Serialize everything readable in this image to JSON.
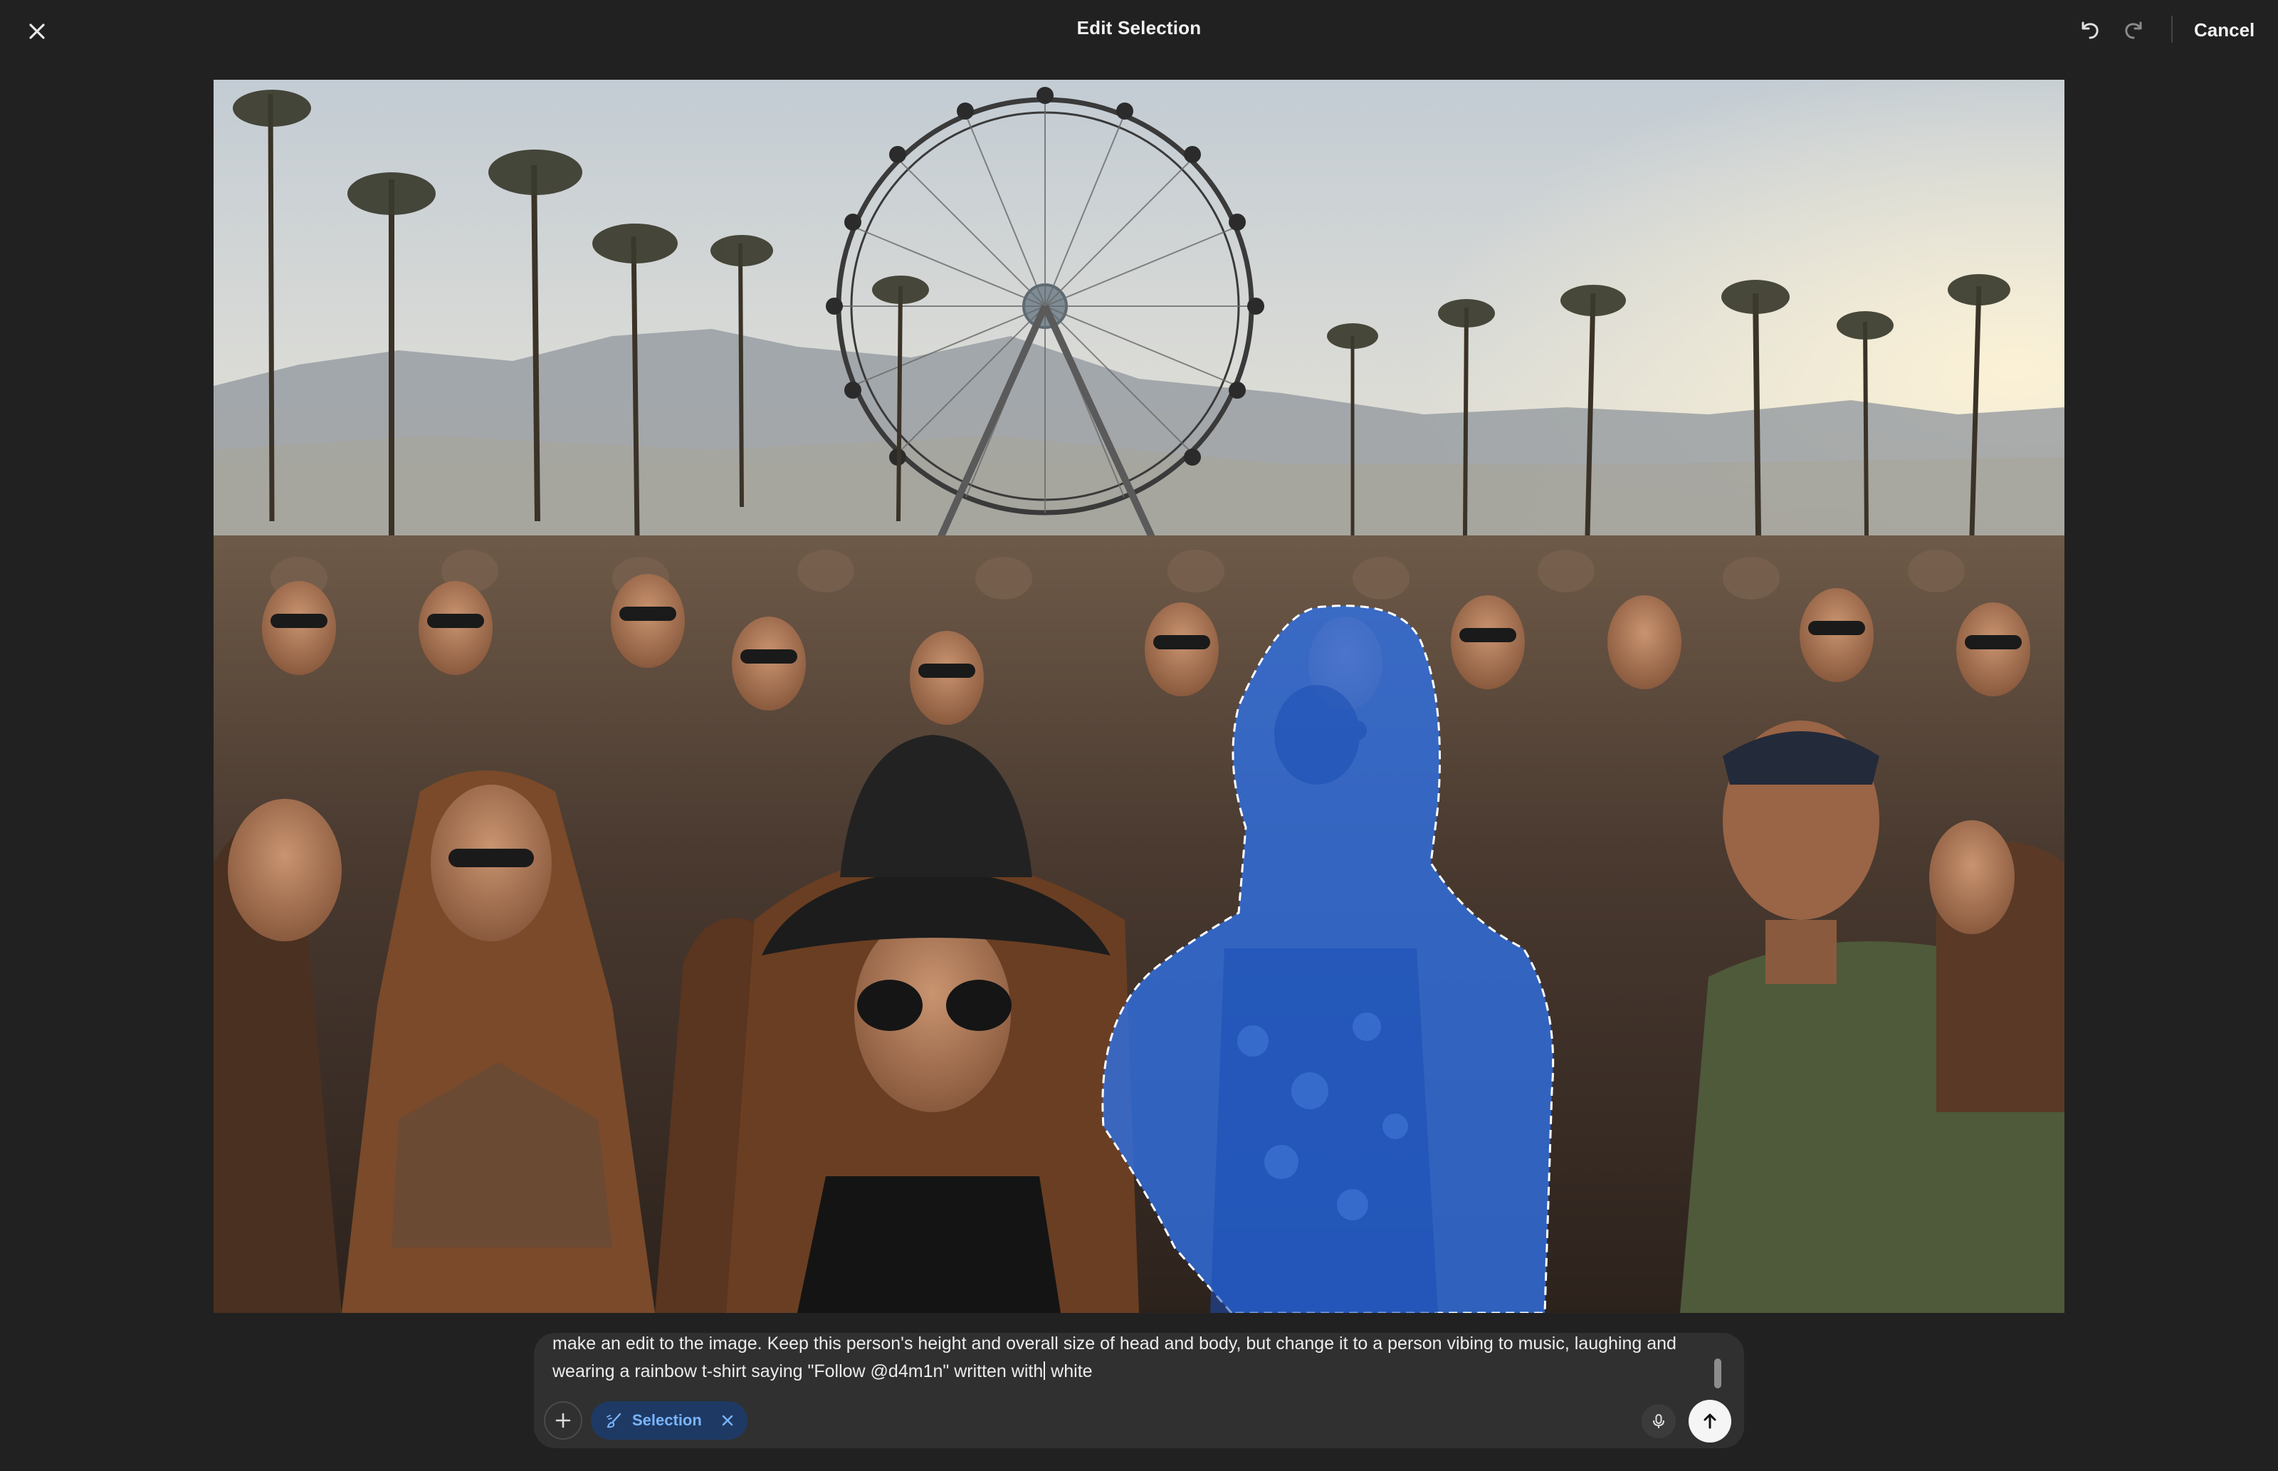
{
  "header": {
    "title": "Edit Selection",
    "close_icon": "close-icon",
    "undo_icon": "undo-icon",
    "redo_icon": "redo-icon",
    "cancel_label": "Cancel"
  },
  "canvas": {
    "image_subject": "crowd at outdoor music festival with ferris wheel and palm trees",
    "selection_mask_color": "#2f6fe0"
  },
  "composer": {
    "prompt_before_caret": "make an edit to the image. Keep this person's height and overall size of head and body, but change it to a person vibing to music, laughing and wearing a rainbow t-shirt saying \"Follow @d4m1n\" written with",
    "prompt_after_caret": " white",
    "add_icon": "plus-icon",
    "chip_icon": "brush-selection-icon",
    "chip_label": "Selection",
    "chip_remove_icon": "close-icon",
    "mic_icon": "microphone-icon",
    "send_icon": "arrow-up-icon"
  },
  "colors": {
    "background": "#212121",
    "composer_bg": "#303030",
    "chip_bg": "#1e3a64",
    "chip_text": "#7ab4ff",
    "send_bg": "#f5f5f5"
  }
}
